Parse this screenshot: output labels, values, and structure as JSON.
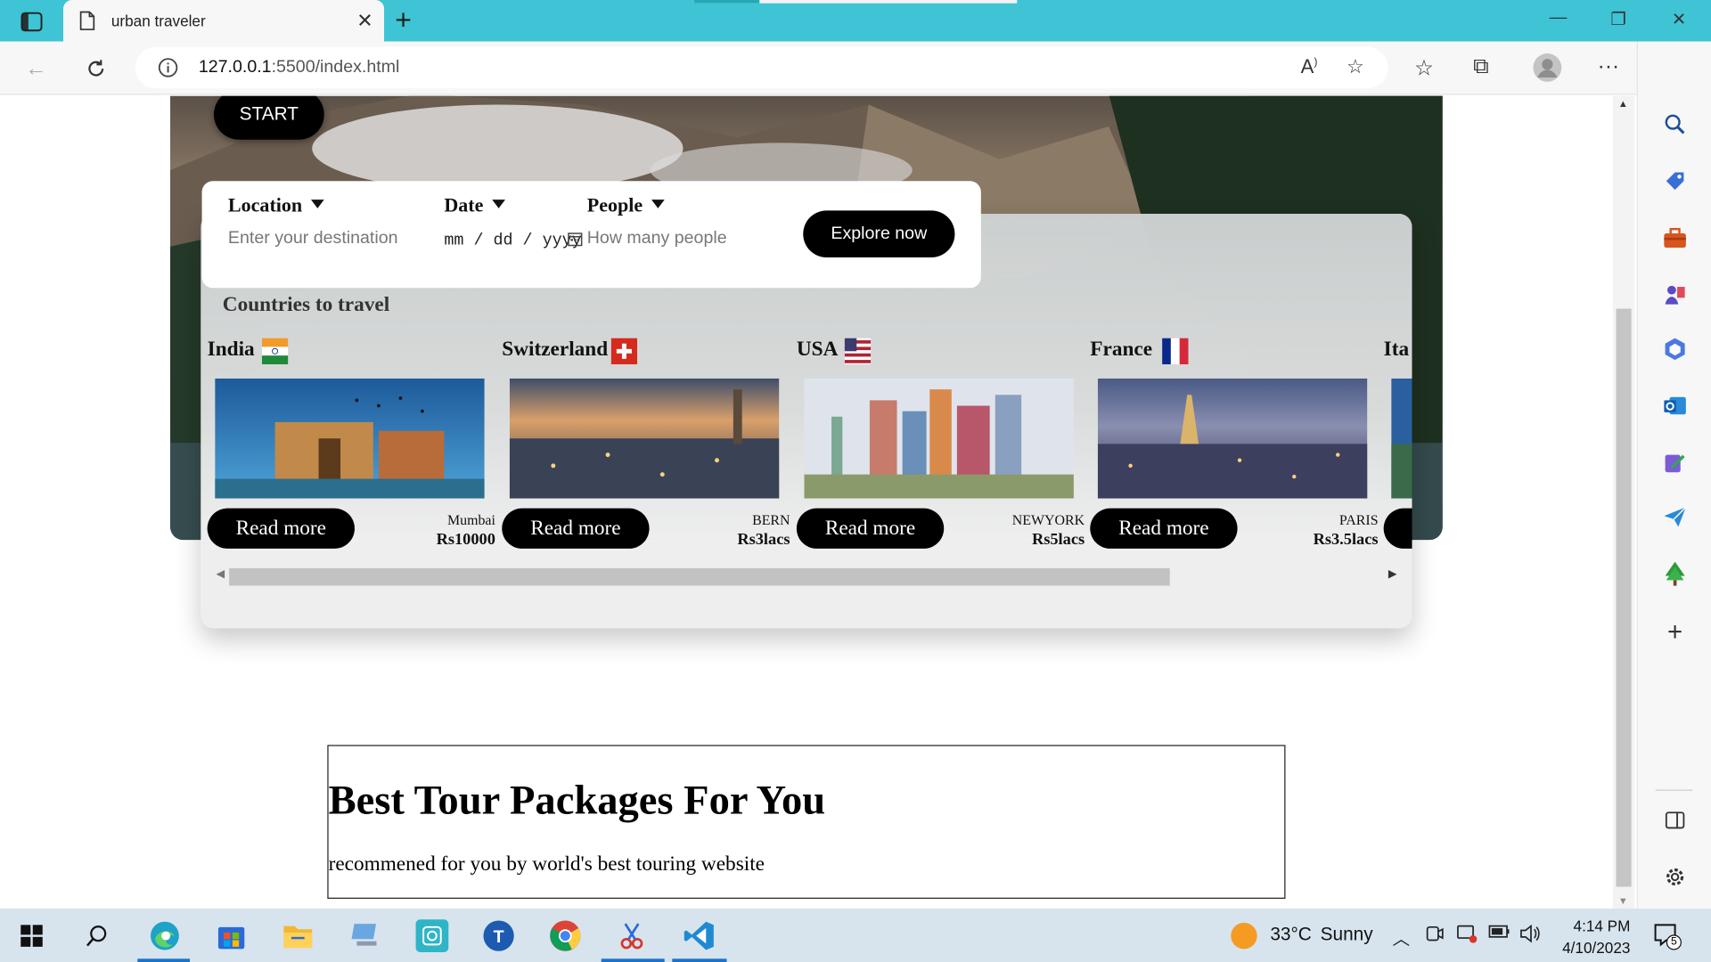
{
  "browser": {
    "tab_title": "urban traveler",
    "url_host": "127.0.0.1",
    "url_rest": ":5500/index.html"
  },
  "hero": {
    "start_label": "START"
  },
  "search": {
    "location_label": "Location",
    "location_placeholder": "Enter your destination",
    "date_label": "Date",
    "date_placeholder": "mm / dd / yyyy",
    "people_label": "People",
    "people_placeholder": "How many people",
    "explore_label": "Explore now"
  },
  "countries": {
    "title": "Countries to travel",
    "items": [
      {
        "name": "India",
        "city": "Mumbai",
        "price": "Rs10000",
        "read_more": "Read more"
      },
      {
        "name": "Switzerland",
        "city": "BERN",
        "price": "Rs3lacs",
        "read_more": "Read more"
      },
      {
        "name": "USA",
        "city": "NEWYORK",
        "price": "Rs5lacs",
        "read_more": "Read more"
      },
      {
        "name": "France",
        "city": "PARIS",
        "price": "Rs3.5lacs",
        "read_more": "Read more"
      },
      {
        "name": "Ita"
      }
    ]
  },
  "tour": {
    "title": "Best Tour Packages For You",
    "subtitle": "recommened for you by world's best touring website"
  },
  "taskbar": {
    "weather_temp": "33°C",
    "weather_text": "Sunny",
    "time": "4:14 PM",
    "date": "4/10/2023",
    "notif_count": "5"
  }
}
